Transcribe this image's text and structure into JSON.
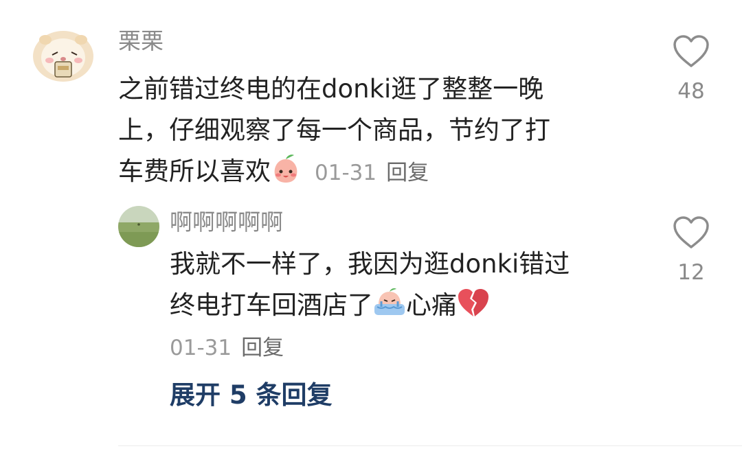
{
  "comment": {
    "username": "栗栗",
    "text_lines": [
      "之前错过终电的在donki逛了整整一晚",
      "上，仔细观察了每一个商品，节约了打",
      "车费所以喜欢"
    ],
    "emoji": "peach-smile-emoji",
    "date": "01-31",
    "reply_label": "回复",
    "likes": "48"
  },
  "reply": {
    "username": "啊啊啊啊啊",
    "text_lines": [
      "我就不一样了，我因为逛donki错过",
      "终电打车回酒店了"
    ],
    "text_tail": "心痛",
    "emojis": [
      "crying-face-emoji",
      "broken-heart-emoji"
    ],
    "date": "01-31",
    "reply_label": "回复",
    "likes": "12"
  },
  "expand_label": "展开 5 条回复",
  "colors": {
    "text": "#222222",
    "username": "#8a8a8a",
    "meta": "#9a9a9a",
    "expand": "#1f3d66",
    "heart_outline": "#8c8c8c",
    "broken_heart": "#e8505b"
  }
}
